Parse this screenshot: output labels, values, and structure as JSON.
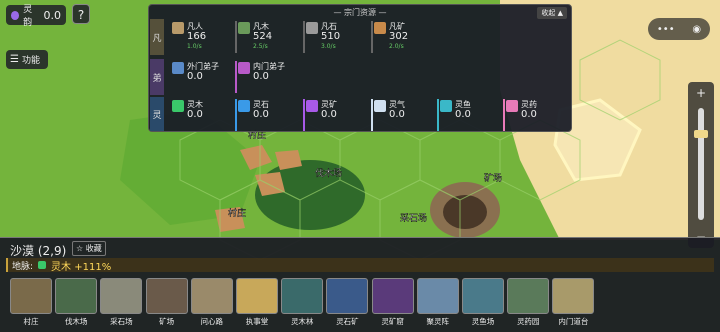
{
  "lingyu": {
    "label": "灵韵",
    "value": "0.0"
  },
  "help_label": "?",
  "func_label": "功能",
  "resources": {
    "title": "— 宗门资源 —",
    "collapse": "收起 ▲",
    "rows": [
      {
        "label": "凡"
      },
      {
        "label": "弟"
      },
      {
        "label": "灵"
      }
    ],
    "fan": [
      {
        "name": "凡人",
        "value": "166",
        "rate": "1.0/s",
        "color": "#b89a6a"
      },
      {
        "name": "凡木",
        "value": "524",
        "rate": "2.5/s",
        "color": "#6a9a5a"
      },
      {
        "name": "凡石",
        "value": "510",
        "rate": "3.0/s",
        "color": "#9a9a9a"
      },
      {
        "name": "凡矿",
        "value": "302",
        "rate": "2.0/s",
        "color": "#c88a4a"
      }
    ],
    "di": [
      {
        "name": "外门弟子",
        "value": "0.0",
        "color": "#5a8ac8"
      },
      {
        "name": "内门弟子",
        "value": "0.0",
        "color": "#b85ac8"
      }
    ],
    "ling": [
      {
        "name": "灵木",
        "value": "0.0",
        "color": "#3ac86a"
      },
      {
        "name": "灵石",
        "value": "0.0",
        "color": "#3a9ae8"
      },
      {
        "name": "灵矿",
        "value": "0.0",
        "color": "#a85ae8"
      },
      {
        "name": "灵气",
        "value": "0.0",
        "color": "#d0e0f0"
      },
      {
        "name": "灵鱼",
        "value": "0.0",
        "color": "#3ab8c8"
      },
      {
        "name": "灵药",
        "value": "0.0",
        "color": "#e87ab8"
      }
    ]
  },
  "map_labels": [
    {
      "text": "村庄"
    },
    {
      "text": "伐木场"
    },
    {
      "text": "矿场"
    },
    {
      "text": "采石场"
    },
    {
      "text": "村庄"
    }
  ],
  "tile": {
    "title": "沙漠 (2,9)",
    "favorite": "☆ 收藏",
    "vein_label": "地脉:",
    "vein_value": "灵木 +111%"
  },
  "buildings": [
    {
      "label": "村庄",
      "color": "#7a6a4a"
    },
    {
      "label": "伐木场",
      "color": "#4a6a4a"
    },
    {
      "label": "采石场",
      "color": "#8a8a7a"
    },
    {
      "label": "矿场",
      "color": "#6a5a4a"
    },
    {
      "label": "问心路",
      "color": "#9a8a6a"
    },
    {
      "label": "执事堂",
      "color": "#c8a85a"
    },
    {
      "label": "灵木林",
      "color": "#3a6a6a"
    },
    {
      "label": "灵石矿",
      "color": "#3a5a8a"
    },
    {
      "label": "灵矿窟",
      "color": "#5a3a7a"
    },
    {
      "label": "聚灵阵",
      "color": "#6a8aa8"
    },
    {
      "label": "灵鱼场",
      "color": "#4a7a8a"
    },
    {
      "label": "灵药园",
      "color": "#5a7a5a"
    },
    {
      "label": "内门道台",
      "color": "#a89a6a"
    }
  ]
}
